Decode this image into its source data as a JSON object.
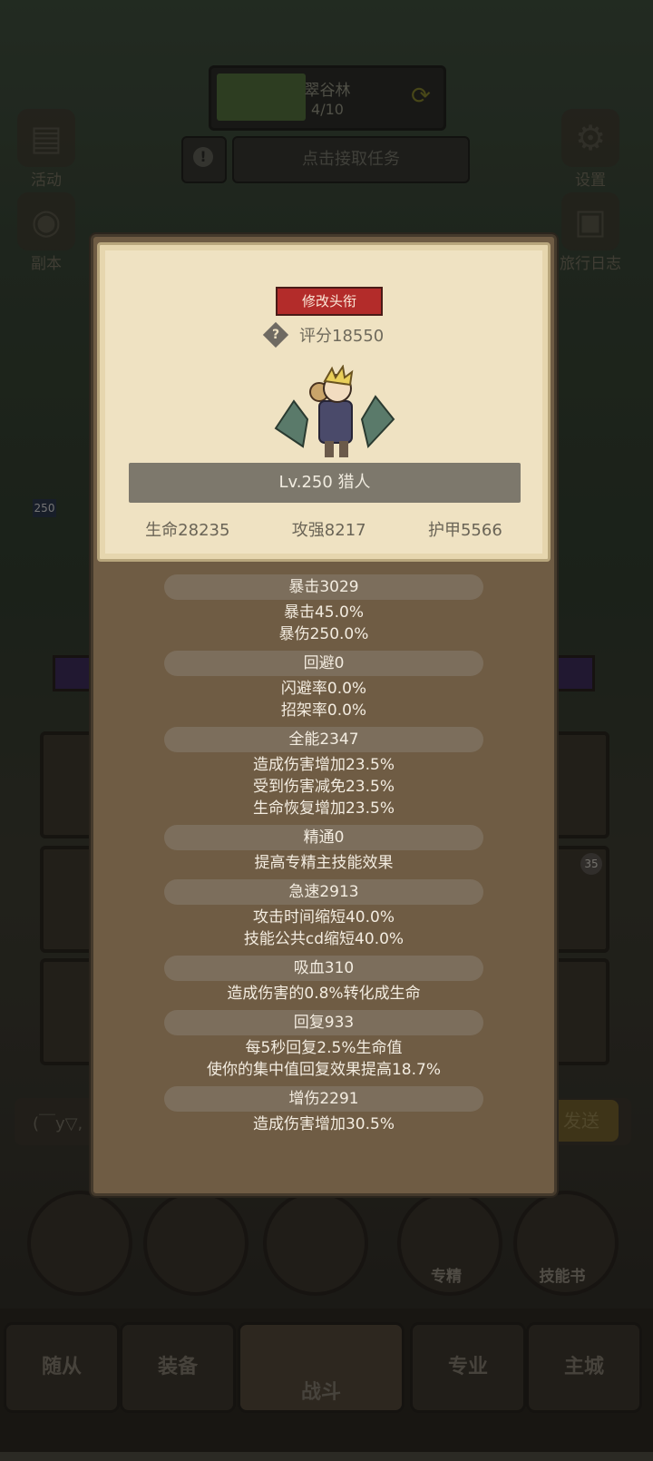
{
  "hud": {
    "quest_name": "翠谷林",
    "quest_progress": "4/10",
    "quest_progress_fraction": 0.4,
    "task_button": "点击接取任务",
    "side_left": [
      {
        "label": "活动",
        "icon": "scroll-icon"
      },
      {
        "label": "副本",
        "icon": "portal-icon"
      }
    ],
    "side_right": [
      {
        "label": "设置",
        "icon": "gear-icon"
      },
      {
        "label": "旅行日志",
        "icon": "book-icon"
      }
    ]
  },
  "background": {
    "level_badge": "250",
    "chat_placeholder": "(￣y▽,",
    "send_label": "发送",
    "round_buttons": [
      {
        "label": ""
      },
      {
        "label": ""
      },
      {
        "label": ""
      },
      {
        "label": "专精"
      },
      {
        "label": "技能书"
      }
    ],
    "nav": [
      {
        "label": "随从"
      },
      {
        "label": "装备"
      },
      {
        "label": "战斗"
      },
      {
        "label": "专业"
      },
      {
        "label": "主城"
      }
    ],
    "slot_badge": "35"
  },
  "profile": {
    "title_button": "修改头衔",
    "score": "评分18550",
    "level_class": "Lv.250 猎人",
    "core_stats": [
      "生命28235",
      "攻强8217",
      "护甲5566"
    ]
  },
  "stats": [
    {
      "header": "暴击3029",
      "lines": [
        "暴击45.0%",
        "暴伤250.0%"
      ]
    },
    {
      "header": "回避0",
      "lines": [
        "闪避率0.0%",
        "招架率0.0%"
      ]
    },
    {
      "header": "全能2347",
      "lines": [
        "造成伤害增加23.5%",
        "受到伤害减免23.5%",
        "生命恢复增加23.5%"
      ]
    },
    {
      "header": "精通0",
      "lines": [
        "提高专精主技能效果"
      ]
    },
    {
      "header": "急速2913",
      "lines": [
        "攻击时间缩短40.0%",
        "技能公共cd缩短40.0%"
      ]
    },
    {
      "header": "吸血310",
      "lines": [
        "造成伤害的0.8%转化成生命"
      ]
    },
    {
      "header": "回复933",
      "lines": [
        "每5秒回复2.5%生命值",
        "使你的集中值回复效果提高18.7%"
      ]
    },
    {
      "header": "增伤2291",
      "lines": [
        "造成伤害增加30.5%"
      ]
    }
  ]
}
